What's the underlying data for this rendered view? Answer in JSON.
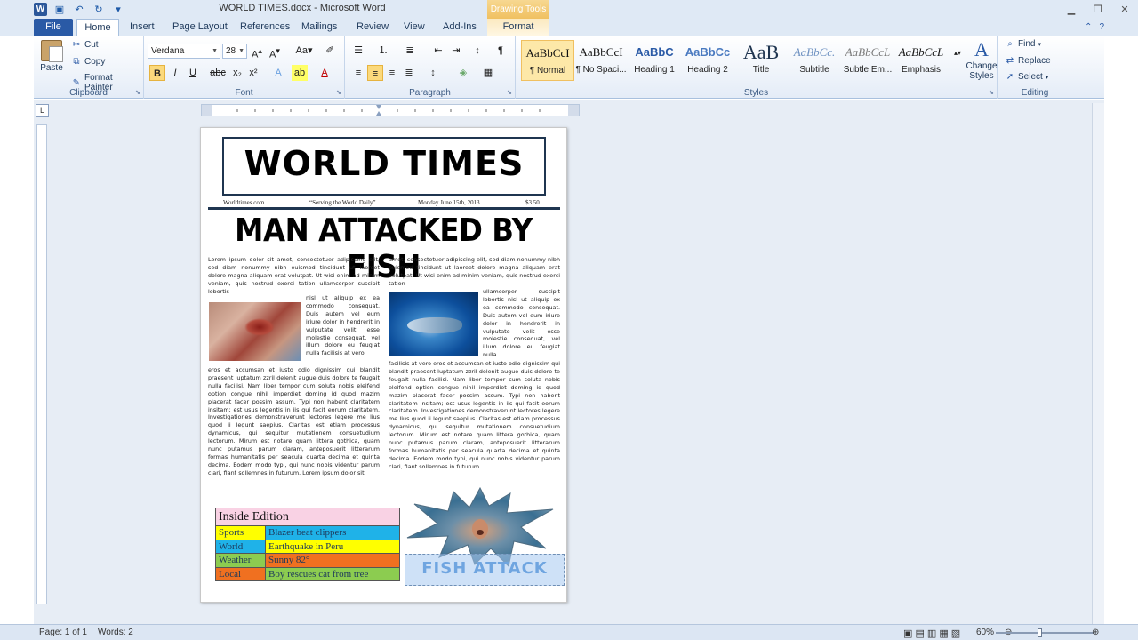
{
  "window": {
    "title": "WORLD TIMES.docx - Microsoft Word",
    "context_tab_group": "Drawing Tools"
  },
  "ribbon_tabs": [
    "File",
    "Home",
    "Insert",
    "Page Layout",
    "References",
    "Mailings",
    "Review",
    "View",
    "Add-Ins",
    "Format"
  ],
  "clipboard": {
    "paste": "Paste",
    "cut": "Cut",
    "copy": "Copy",
    "format_painter": "Format Painter",
    "group": "Clipboard"
  },
  "font": {
    "name": "Verdana",
    "size": "28",
    "group": "Font"
  },
  "paragraph": {
    "group": "Paragraph"
  },
  "styles": {
    "group": "Styles",
    "change_styles": "Change Styles",
    "items": [
      {
        "preview": "AaBbCcI",
        "name": "¶ Normal"
      },
      {
        "preview": "AaBbCcI",
        "name": "¶ No Spaci..."
      },
      {
        "preview": "AaBbC",
        "name": "Heading 1"
      },
      {
        "preview": "AaBbCc",
        "name": "Heading 2"
      },
      {
        "preview": "AaB",
        "name": "Title"
      },
      {
        "preview": "AaBbCc.",
        "name": "Subtitle"
      },
      {
        "preview": "AaBbCcL",
        "name": "Subtle Em..."
      },
      {
        "preview": "AaBbCcL",
        "name": "Emphasis"
      }
    ]
  },
  "editing": {
    "group": "Editing",
    "find": "Find",
    "replace": "Replace",
    "select": "Select"
  },
  "document": {
    "masthead": "WORLD TIMES",
    "info": {
      "site": "Worldtimes.com",
      "motto": "“Serving the World Daily”",
      "date": "Monday June 15th, 2013",
      "price": "$3.50"
    },
    "headline": "MAN ATTACKED BY FISH",
    "col1_top": "Lorem ipsum dolor sit amet, consectetuer adipiscing elit, sed diam nonummy nibh euismod tincidunt ut laoreet dolore magna aliquam erat volutpat. Ut wisi enim ad minim veniam, quis nostrud exerci tation ullamcorper suscipit lobortis",
    "col1_wrap": "nisl ut aliquip ex ea commodo consequat. Duis autem vel eum iriure dolor in hendrerit in vulputate velit esse molestie consequat, vel illum dolore eu feugiat nulla facilisis at vero",
    "col1_bottom": "eros et accumsan et iusto odio dignissim qui blandit praesent luptatum zzril delenit augue duis dolore te feugait nulla facilisi. Nam liber tempor cum soluta nobis eleifend option congue nihil imperdiet doming id quod mazim placerat facer possim assum. Typi non habent claritatem insitam; est usus legentis in iis qui facit eorum claritatem. Investigationes demonstraverunt lectores legere me lius quod ii legunt saepius. Claritas est etiam processus dynamicus, qui sequitur mutationem consuetudium lectorum. Mirum est notare quam littera gothica, quam nunc putamus parum claram, anteposuerit litterarum formas humanitatis per seacula quarta decima et quinta decima. Eodem modo typi, qui nunc nobis videntur parum clari, fiant sollemnes in futurum. Lorem ipsum dolor sit",
    "col2_top": "amet, consectetuer adipiscing elit, sed diam nonummy nibh euismod tincidunt ut laoreet dolore magna aliquam erat volutpat. Ut wisi enim ad minim veniam, quis nostrud exerci tation",
    "col2_wrap": "ullamcorper suscipit lobortis nisl ut aliquip ex ea commodo consequat. Duis autem vel eum iriure dolor in hendrerit in vulputate velit esse molestie consequat, vel illum dolore eu feugiat nulla",
    "col2_bottom": "facilisis at vero eros et accumsan et iusto odio dignissim qui blandit praesent luptatum zzril delenit augue duis dolore te feugait nulla facilisi. Nam liber tempor cum soluta nobis eleifend option congue nihil imperdiet doming id quod mazim placerat facer possim assum. Typi non habent claritatem insitam; est usus legentis in iis qui facit eorum claritatem. Investigationes demonstraverunt lectores legere me lius quod ii legunt saepius. Claritas est etiam processus dynamicus, qui sequitur mutationem consuetudium lectorum. Mirum est notare quam littera gothica, quam nunc putamus parum claram, anteposuerit litterarum formas humanitatis per seacula quarta decima et quinta decima. Eodem modo typi, qui nunc nobis videntur parum clari, fiant sollemnes in futurum.",
    "inside": {
      "title": "Inside Edition",
      "rows": [
        {
          "section": "Sports",
          "story": "Blazer beat clippers",
          "section_color": "#ffff00",
          "story_color": "#1fb2e8"
        },
        {
          "section": "World",
          "story": "Earthquake in Peru",
          "section_color": "#1fb2e8",
          "story_color": "#ffff00"
        },
        {
          "section": "Weather",
          "story": "Sunny 82°",
          "section_color": "#8ccc50",
          "story_color": "#f07020"
        },
        {
          "section": "Local",
          "story": "Boy rescues cat from tree",
          "section_color": "#f07020",
          "story_color": "#8ccc50"
        }
      ]
    },
    "wordart": "FISH ATTACK"
  },
  "status": {
    "page": "Page: 1 of 1",
    "words": "Words: 2",
    "zoom": "60%"
  }
}
